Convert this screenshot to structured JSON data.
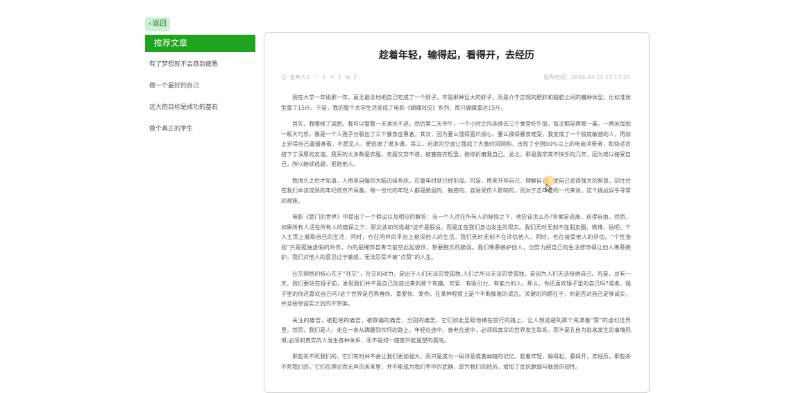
{
  "back": {
    "label": "返回",
    "icon": "chevron-left-icon"
  },
  "sidebar": {
    "title": "推荐文章",
    "items": [
      {
        "label": "有了梦想就不会感到疲惫"
      },
      {
        "label": "做一个最好的自己"
      },
      {
        "label": "远大的目标是成功的基石"
      },
      {
        "label": "做个真正的学生"
      }
    ]
  },
  "article": {
    "title": "趁着年轻，输得起，看得开，去经历",
    "meta": {
      "author": "发布人1",
      "likes": "1",
      "comments": "1",
      "shares": "2",
      "published": "发布时间：2024-03-11 11:13:20"
    },
    "paragraphs": [
      "我在大学一年级那一年，莫无最念地把自己吃成了一个胖子。不是那种巨大的胖子，而是介于正规的肥胖和脂肪之间的臃肿体型，比标准体型重了15斤。于是，我的整个大学生活变成了电影《蝴蝶效应》系列，那只蝴蝶重达15斤。",
      "首先，我哪候了减肥。我可以整整一天滴水不进，然后第二天中午，一个小时之内连续去三个食堂吃午饭，每次都是两荤一素。一两米饭加一瓶大可乐，像是一个人孢子分裂出了三个暴食症患者。其次，因为要么饿得面爪掠心，要么撑得暴食难受，我变成了一个极度敏感的人，再加上觉得自己邋遢难看，不愿见人，便逃掉了很多课。其三，迫求的空虚让我戒了大量时间网购，击败了全国90%以上的电商消费者，和快递员结下了深厚的友谊。我买的大多数是衣服，衣服又穿不进，被塞在衣柜里，继续折磨我自己。总之，那是我非常不快乐的几年，因为难以接受自己，所以继续逃避，拒绝他人。",
      "我很久之后才知道，人用来自慢的大脑边缘系统，在童年时就已经形成。可是，用来开导自己、理解自己、使自己变得强大的智慧，却往往在我们本该成熟的年纪依然不具备。每一世代的年轻人都是脆弱的、敏感的、容易受伤人影响的，而对于正年轻的一代来说，这个挑战异乎寻常的艰难。",
      "电影《楚门的世界》中提出了一个假设以及相应的解答：当一个人活在所有人的窥探之下，他应该怎么办?答案是逃离，获得自由。然而，如果所有人活在所有人的窥探之下，那又该如何逃避?这不是假设，而是正在我们身边发生的现实。我们无时无刻不在朋友圈、微博、贴吧、个人主页上展现自己的生活，同时，也在同样的平台上窥探他人的生活。我们无时无刻不在评估他人，同时，也在接受他人的评估。“个性张扬”只是孤独虚假的外衣，为的是掩饰自卑与前空此起彼伏，想要抱乐的脆弱。我们羡慕嫉妒他人，也努力把自己的生活修饰得让他人羡慕嫉妒。我们对他人的意见过于敏感，无法忍受不被“点赞”的人生。",
      "社交网络的核心在于“社交”，社交的动力，是出于人们无法忍受孤独;人们之所以无法忍受孤独，是因为人们无法接纳自己。可是，总有一天，我们要站在镜子前，发现我们并不是自己创造出来的那个有趣、可爱、有吸引力、有能力的人。那么，你还喜欢镜子里的自己吗?或者，镜子里的你还喜欢自己吗?这个世界是否称善你、喜爱你、爱你，在某种程度上是个不断膨胀的谎言。关键的问题在于，你是否对自己足够诚实，并且接受诚实之后的不完美。",
      "关注的痛苦，被拒绝的痛苦，被欺骗的痛苦，分别的痛苦，它们如此显眼地横在前行的路上，让人想逃避到那个充满着“赞”的虚幻世界里。然而，我们是人，走在一条从蹒跚到坎坷的路上，年轻在途中，衰老在途中，必须和真实的世界发生联系，而不是孔自为尚来发生的事情恐惧;必须和真实的人发生各种关系，而不是如一座座只能遥望的孤岛。",
      "那些杀不死我们的，它们有时并不会让我们更加强大，而只是成为一段诗意或者幽暗的记忆。趁着年轻，输得起，看得开，去经历。那些杀不死我们的，它们在理论而无声的未来里，并不能成为我们手中的武器，却为我们的经历，增加了反抗脆弱与敏感的韧性。"
    ]
  }
}
